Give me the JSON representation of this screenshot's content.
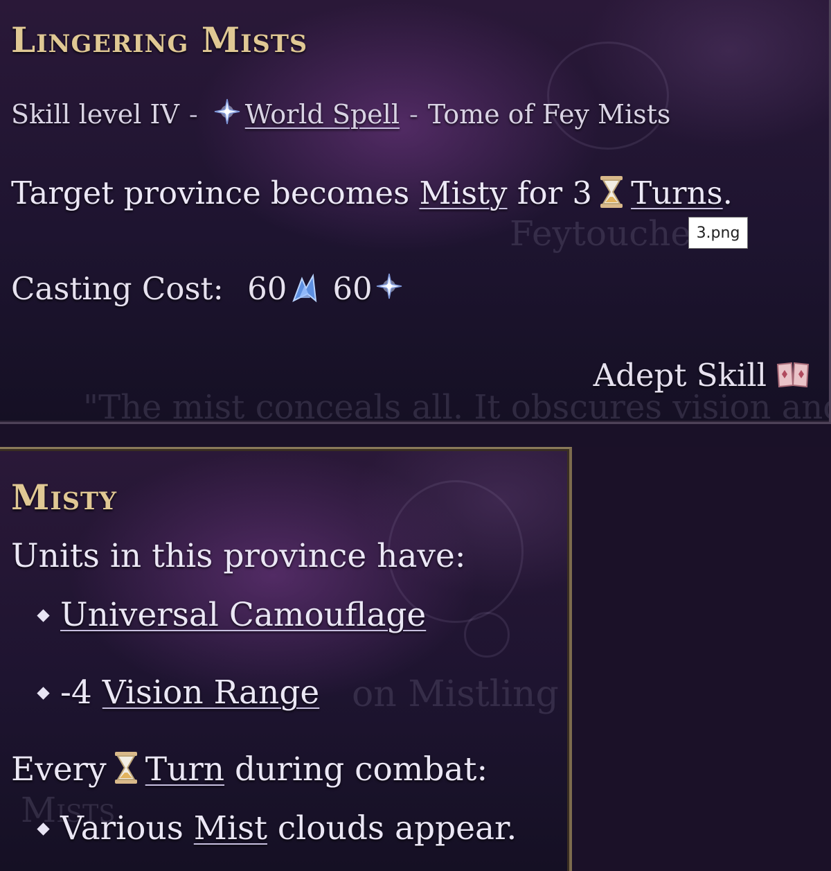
{
  "skill_tooltip": {
    "title": "Lingering Mists",
    "subtitle": {
      "level": "Skill level IV",
      "separator": "-",
      "type": "World Spell",
      "source": "Tome of Fey Mists"
    },
    "description": {
      "prefix": "Target province becomes",
      "status": "Misty",
      "middle": "for 3",
      "unit": "Turns",
      "suffix": "."
    },
    "cost": {
      "label": "Casting Cost:",
      "amounts": [
        "60",
        "60"
      ],
      "icons": [
        "mana-essence-icon",
        "spell-star-icon"
      ]
    },
    "tier": "Adept Skill",
    "tier_icon": "spellbook-icon",
    "background_text": {
      "unit_name": "Feytouched",
      "flavor": "\"The mist conceals all. It obscures vision and c"
    }
  },
  "file_tooltip": "3.png",
  "status_tooltip": {
    "title": "Misty",
    "intro": "Units in this province have:",
    "effects": [
      {
        "prefix": "",
        "link": "Universal Camouflage"
      },
      {
        "prefix": "-4",
        "link": "Vision Range"
      }
    ],
    "combat_intro": {
      "prefix": "Every",
      "link": "Turn",
      "suffix": "during combat:"
    },
    "combat_effect": {
      "prefix": "Various",
      "link": "Mist",
      "suffix": "clouds appear."
    },
    "background_text": {
      "unit_name": "on Mistling",
      "heading": "Mists"
    }
  },
  "colors": {
    "title_gold": "#e0c894",
    "panel_bg": "#1e1430",
    "border_gold": "#8a7a5a"
  }
}
